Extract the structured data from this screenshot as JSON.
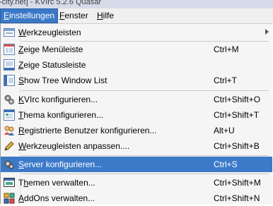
{
  "titlebar": {
    "text": "-city.net] - KVIrc 5.2.6 Quasar"
  },
  "menubar": {
    "items": [
      {
        "mnemonic": "E",
        "rest": "instellungen"
      },
      {
        "mnemonic": "F",
        "rest": "enster"
      },
      {
        "mnemonic": "H",
        "rest": "ilfe"
      }
    ]
  },
  "menu": {
    "items": [
      {
        "pre": "",
        "mnemonic": "W",
        "post": "erkzeugleisten",
        "shortcut": "",
        "icon": "toolbar-icon"
      },
      {
        "pre": "",
        "mnemonic": "Z",
        "post": "eige Menüleiste",
        "shortcut": "Ctrl+M",
        "icon": "menubar-icon"
      },
      {
        "pre": "",
        "mnemonic": "Z",
        "post": "eige Statusleiste",
        "shortcut": "",
        "icon": "statusbar-icon"
      },
      {
        "pre": "",
        "mnemonic": "S",
        "post": "how Tree Window List",
        "shortcut": "Ctrl+T",
        "icon": "tree-window-icon"
      },
      {
        "pre": "",
        "mnemonic": "K",
        "post": "VIrc konfigurieren...",
        "shortcut": "Ctrl+Shift+O",
        "icon": "gears-icon"
      },
      {
        "pre": "",
        "mnemonic": "T",
        "post": "hema konfigurieren...",
        "shortcut": "Ctrl+Shift+T",
        "icon": "theme-icon"
      },
      {
        "pre": "",
        "mnemonic": "R",
        "post": "egistrierte Benutzer konfigurieren...",
        "shortcut": "Alt+U",
        "icon": "users-icon"
      },
      {
        "pre": "",
        "mnemonic": "W",
        "post": "erkzeugleisten anpassen....",
        "shortcut": "Ctrl+Shift+B",
        "icon": "pencil-icon"
      },
      {
        "pre": "",
        "mnemonic": "S",
        "post": "erver konfigurieren...",
        "shortcut": "Ctrl+S",
        "icon": "server-icon"
      },
      {
        "pre": "T",
        "mnemonic": "h",
        "post": "emen verwalten...",
        "shortcut": "Ctrl+Shift+M",
        "icon": "themes-icon"
      },
      {
        "pre": "",
        "mnemonic": "A",
        "post": "ddOns verwalten...",
        "shortcut": "Ctrl+Shift+N",
        "icon": "addons-icon"
      }
    ]
  },
  "colors": {
    "highlight": "#3c7ac8",
    "menubar_active": "#3b79c7"
  }
}
